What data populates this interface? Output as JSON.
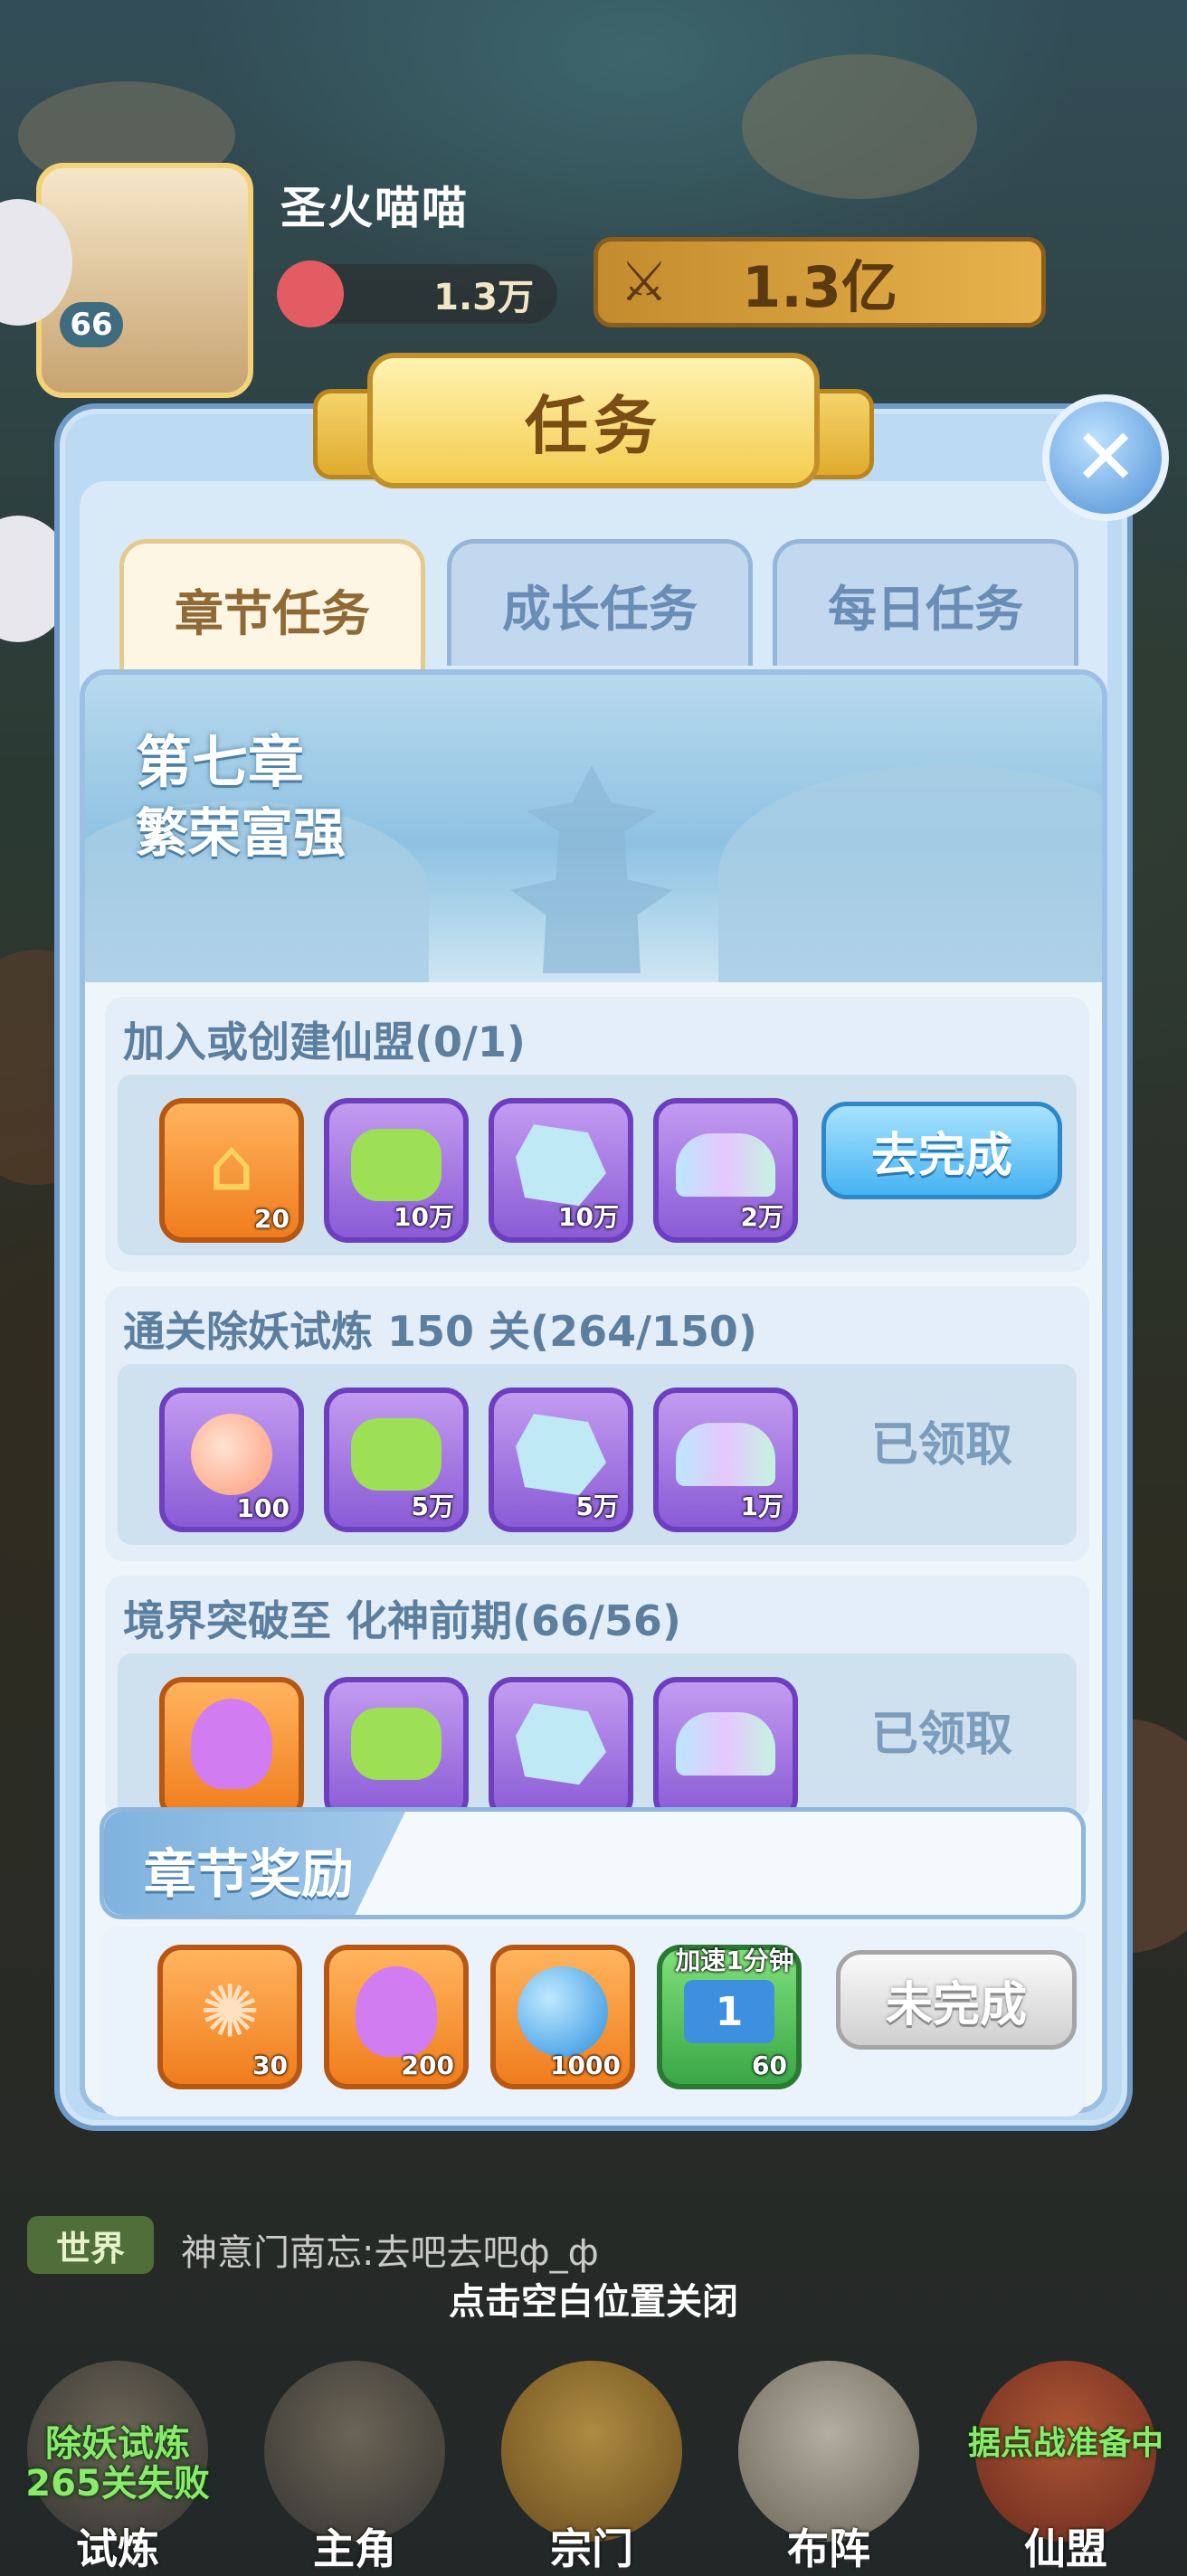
{
  "header": {
    "player_name": "圣火喵喵",
    "level": "66",
    "stat_1": "1.3万",
    "combat_power": "1.3亿"
  },
  "modal": {
    "title": "任务",
    "tabs": [
      {
        "label": "章节任务",
        "active": true
      },
      {
        "label": "成长任务",
        "active": false
      },
      {
        "label": "每日任务",
        "active": false
      }
    ],
    "chapter": {
      "number": "第七章",
      "name": "繁荣富强"
    },
    "tasks": [
      {
        "title": "加入或创建仙盟(0/1)",
        "rewards": [
          {
            "icon": "house-token-icon",
            "qty": "20",
            "rarity": "orange"
          },
          {
            "icon": "green-jade-icon",
            "qty": "10万",
            "rarity": "purple"
          },
          {
            "icon": "blue-crystal-icon",
            "qty": "10万",
            "rarity": "purple"
          },
          {
            "icon": "rainbow-scale-icon",
            "qty": "2万",
            "rarity": "purple"
          }
        ],
        "action": "去完成"
      },
      {
        "title": "通关除妖试炼 150 关(264/150)",
        "rewards": [
          {
            "icon": "peach-icon",
            "qty": "100",
            "rarity": "purple"
          },
          {
            "icon": "green-jade-icon",
            "qty": "5万",
            "rarity": "purple"
          },
          {
            "icon": "blue-crystal-icon",
            "qty": "5万",
            "rarity": "purple"
          },
          {
            "icon": "rainbow-scale-icon",
            "qty": "1万",
            "rarity": "purple"
          }
        ],
        "action": "已领取"
      },
      {
        "title": "境界突破至 化神前期(66/56)",
        "rewards": [
          {
            "icon": "purple-flame-icon",
            "qty": "",
            "rarity": "orange"
          },
          {
            "icon": "green-jade-icon",
            "qty": "",
            "rarity": "purple"
          },
          {
            "icon": "blue-crystal-icon",
            "qty": "",
            "rarity": "purple"
          },
          {
            "icon": "rainbow-scale-icon",
            "qty": "",
            "rarity": "purple"
          }
        ],
        "action": "已领取"
      }
    ],
    "chapter_reward": {
      "label": "章节奖励",
      "rewards": [
        {
          "icon": "fire-scroll-icon",
          "qty": "30",
          "rarity": "orange"
        },
        {
          "icon": "purple-flame-icon",
          "qty": "200",
          "rarity": "orange"
        },
        {
          "icon": "blue-orb-icon",
          "qty": "1000",
          "rarity": "orange"
        },
        {
          "icon": "speedup-ticket-icon",
          "qty": "60",
          "tag": "加速1分钟",
          "rarity": "green"
        }
      ],
      "action": "未完成"
    }
  },
  "hint": "点击空白位置关闭",
  "world_chat": {
    "tag": "世界",
    "message": "神意门南忘:去吧去吧ф_ф"
  },
  "nav": [
    {
      "label": "试炼",
      "badge": "除妖试炼\n265关失败"
    },
    {
      "label": "主角",
      "badge": ""
    },
    {
      "label": "宗门",
      "badge": ""
    },
    {
      "label": "布阵",
      "badge": ""
    },
    {
      "label": "仙盟",
      "badge": "据点战准备中"
    }
  ],
  "colors": {
    "modal_bg": "#bcdaf2",
    "go_button": "#45b3f1",
    "title_plate": "#f4cc4e"
  }
}
